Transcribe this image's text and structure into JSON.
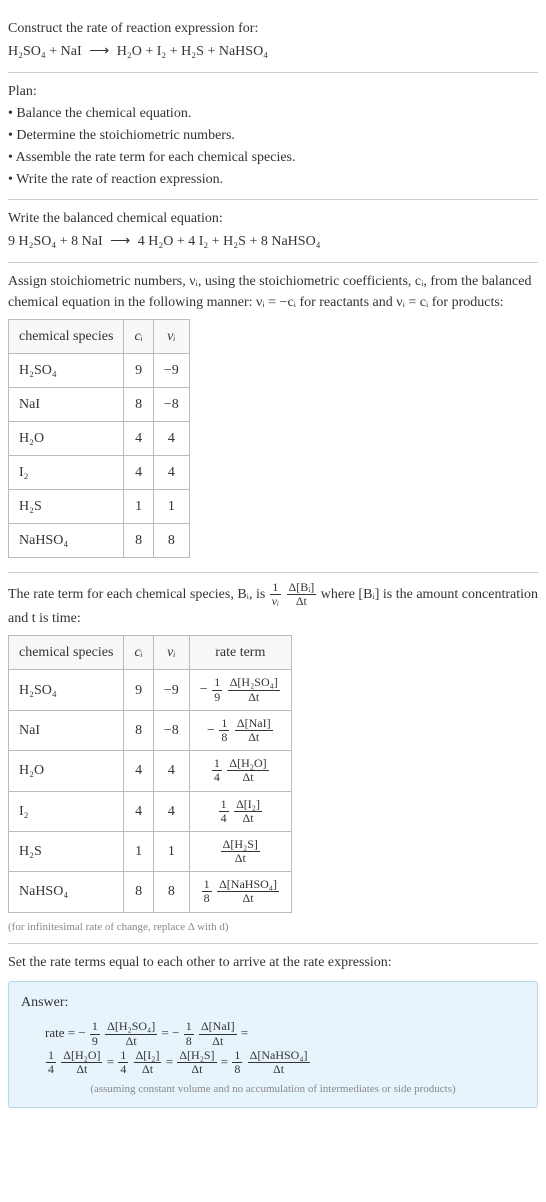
{
  "header": {
    "prompt": "Construct the rate of reaction expression for:",
    "equation_lhs": "H₂SO₄ + NaI",
    "equation_arrow": "⟶",
    "equation_rhs": "H₂O + I₂ + H₂S + NaHSO₄"
  },
  "plan": {
    "title": "Plan:",
    "items": [
      "• Balance the chemical equation.",
      "• Determine the stoichiometric numbers.",
      "• Assemble the rate term for each chemical species.",
      "• Write the rate of reaction expression."
    ]
  },
  "balanced": {
    "title": "Write the balanced chemical equation:",
    "equation_lhs": "9 H₂SO₄ + 8 NaI",
    "equation_arrow": "⟶",
    "equation_rhs": "4 H₂O + 4 I₂ + H₂S + 8 NaHSO₄"
  },
  "stoich": {
    "intro_1": "Assign stoichiometric numbers, νᵢ, using the stoichiometric coefficients, cᵢ, from the balanced chemical equation in the following manner: νᵢ = −cᵢ for reactants and νᵢ = cᵢ for products:",
    "headers": {
      "species": "chemical species",
      "ci": "cᵢ",
      "vi": "νᵢ"
    },
    "rows": [
      {
        "species": "H₂SO₄",
        "ci": "9",
        "vi": "−9"
      },
      {
        "species": "NaI",
        "ci": "8",
        "vi": "−8"
      },
      {
        "species": "H₂O",
        "ci": "4",
        "vi": "4"
      },
      {
        "species": "I₂",
        "ci": "4",
        "vi": "4"
      },
      {
        "species": "H₂S",
        "ci": "1",
        "vi": "1"
      },
      {
        "species": "NaHSO₄",
        "ci": "8",
        "vi": "8"
      }
    ]
  },
  "rate_terms": {
    "intro_pre": "The rate term for each chemical species, Bᵢ, is ",
    "intro_frac_outer_num": "1",
    "intro_frac_outer_den": "νᵢ",
    "intro_frac_inner_num": "Δ[Bᵢ]",
    "intro_frac_inner_den": "Δt",
    "intro_post": " where [Bᵢ] is the amount concentration and t is time:",
    "headers": {
      "species": "chemical species",
      "ci": "cᵢ",
      "vi": "νᵢ",
      "rate": "rate term"
    },
    "rows": [
      {
        "species": "H₂SO₄",
        "ci": "9",
        "vi": "−9",
        "coef": "− ",
        "num": "1",
        "den": "9",
        "dnum": "Δ[H₂SO₄]",
        "dden": "Δt"
      },
      {
        "species": "NaI",
        "ci": "8",
        "vi": "−8",
        "coef": "− ",
        "num": "1",
        "den": "8",
        "dnum": "Δ[NaI]",
        "dden": "Δt"
      },
      {
        "species": "H₂O",
        "ci": "4",
        "vi": "4",
        "coef": "",
        "num": "1",
        "den": "4",
        "dnum": "Δ[H₂O]",
        "dden": "Δt"
      },
      {
        "species": "I₂",
        "ci": "4",
        "vi": "4",
        "coef": "",
        "num": "1",
        "den": "4",
        "dnum": "Δ[I₂]",
        "dden": "Δt"
      },
      {
        "species": "H₂S",
        "ci": "1",
        "vi": "1",
        "coef": "",
        "num": "",
        "den": "",
        "dnum": "Δ[H₂S]",
        "dden": "Δt"
      },
      {
        "species": "NaHSO₄",
        "ci": "8",
        "vi": "8",
        "coef": "",
        "num": "1",
        "den": "8",
        "dnum": "Δ[NaHSO₄]",
        "dden": "Δt"
      }
    ],
    "footnote": "(for infinitesimal rate of change, replace Δ with d)"
  },
  "final": {
    "title": "Set the rate terms equal to each other to arrive at the rate expression:"
  },
  "answer": {
    "label": "Answer:",
    "rate_label": "rate = ",
    "terms": [
      {
        "coef": "− ",
        "num": "1",
        "den": "9",
        "dnum": "Δ[H₂SO₄]",
        "dden": "Δt"
      },
      {
        "coef": "− ",
        "num": "1",
        "den": "8",
        "dnum": "Δ[NaI]",
        "dden": "Δt"
      },
      {
        "coef": "",
        "num": "1",
        "den": "4",
        "dnum": "Δ[H₂O]",
        "dden": "Δt"
      },
      {
        "coef": "",
        "num": "1",
        "den": "4",
        "dnum": "Δ[I₂]",
        "dden": "Δt"
      },
      {
        "coef": "",
        "num": "",
        "den": "",
        "dnum": "Δ[H₂S]",
        "dden": "Δt"
      },
      {
        "coef": "",
        "num": "1",
        "den": "8",
        "dnum": "Δ[NaHSO₄]",
        "dden": "Δt"
      }
    ],
    "note": "(assuming constant volume and no accumulation of intermediates or side products)"
  }
}
